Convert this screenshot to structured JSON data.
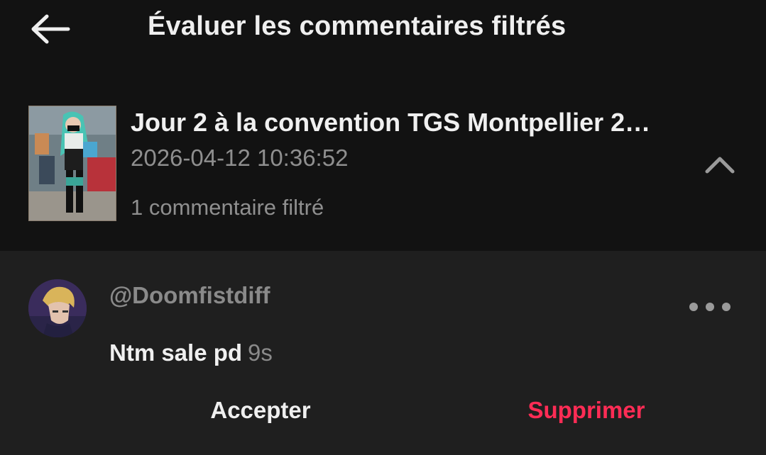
{
  "header": {
    "back_icon": "arrow-left-icon",
    "title": "Évaluer les commentaires filtrés"
  },
  "video": {
    "title": "Jour 2 à la convention TGS Montpellier 2…",
    "date": "2026-04-12 10:36:52",
    "filtered_count": "1 commentaire filtré",
    "collapse_icon": "chevron-up-icon"
  },
  "comment": {
    "username": "@Doomfistdiff",
    "text": "Ntm sale pd",
    "time": "9s",
    "more_icon": "more-horizontal-icon"
  },
  "actions": {
    "accept_label": "Accepter",
    "delete_label": "Supprimer"
  },
  "colors": {
    "background": "#121212",
    "comment_background": "#1f1f1f",
    "delete_accent": "#fe2c55",
    "muted_text": "#8f8f8f"
  }
}
